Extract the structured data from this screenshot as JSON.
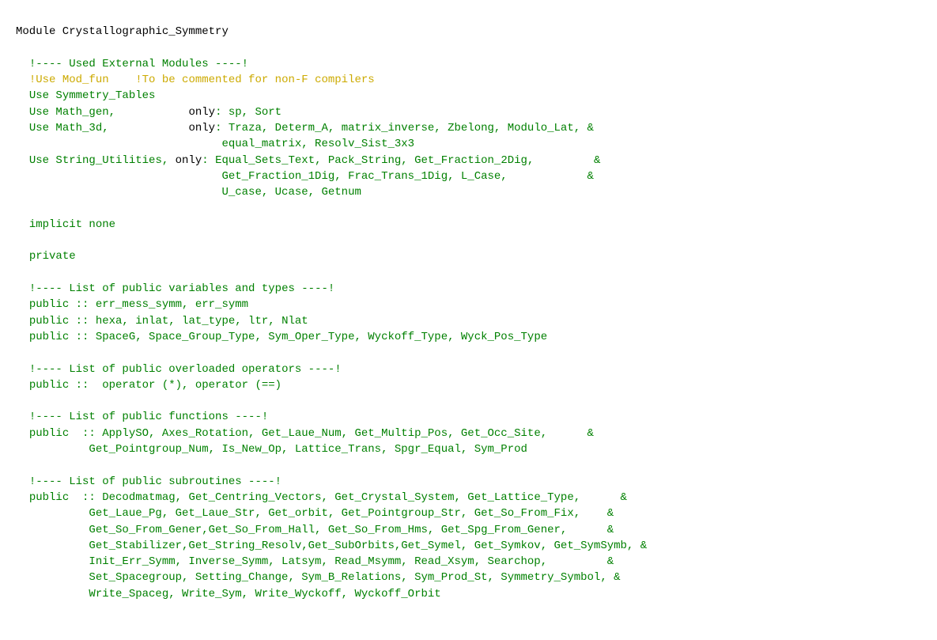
{
  "code": {
    "module_line": "Module Crystallographic_Symmetry",
    "sections": [
      {
        "type": "comment",
        "text": "!---- Used External Modules ----!"
      },
      {
        "type": "comment_yellow",
        "text": "!Use Mod_fun    !To be commented for non-F compilers"
      },
      {
        "type": "use",
        "text": "Use Symmetry_Tables"
      },
      {
        "type": "use",
        "text": "Use Math_gen,           only: sp, Sort"
      },
      {
        "type": "use_multi",
        "text": "Use Math_3d,            only: Traza, Determ_A, matrix_inverse, Zbelong, Modulo_Lat, &\n                               equal_matrix, Resolv_Sist_3x3"
      },
      {
        "type": "use_multi",
        "text": "Use String_Utilities, only: Equal_Sets_Text, Pack_String, Get_Fraction_2Dig,         &\n                               Get_Fraction_1Dig, Frac_Trans_1Dig, L_Case,            &\n                               U_case, Ucase, Getnum"
      },
      {
        "type": "implicit",
        "text": "implicit none"
      },
      {
        "type": "private",
        "text": "private"
      },
      {
        "type": "comment",
        "text": "!---- List of public variables and types ----!"
      },
      {
        "type": "public",
        "text": "public :: err_mess_symm, err_symm"
      },
      {
        "type": "public",
        "text": "public :: hexa, inlat, lat_type, ltr, Nlat"
      },
      {
        "type": "public",
        "text": "public :: SpaceG, Space_Group_Type, Sym_Oper_Type, Wyckoff_Type, Wyck_Pos_Type"
      },
      {
        "type": "comment",
        "text": "!---- List of public overloaded operators ----!"
      },
      {
        "type": "public",
        "text": "public ::  operator (*), operator (==)"
      },
      {
        "type": "comment",
        "text": "!---- List of public functions ----!"
      },
      {
        "type": "public_multi",
        "text": "public  :: ApplySO, Axes_Rotation, Get_Laue_Num, Get_Multip_Pos, Get_Occ_Site,      &\n           Get_Pointgroup_Num, Is_New_Op, Lattice_Trans, Spgr_Equal, Sym_Prod"
      },
      {
        "type": "comment",
        "text": "!---- List of public subroutines ----!"
      },
      {
        "type": "public_multi",
        "text": "public  :: Decodmatmag, Get_Centring_Vectors, Get_Crystal_System, Get_Lattice_Type,      &\n           Get_Laue_Pg, Get_Laue_Str, Get_orbit, Get_Pointgroup_Str, Get_So_From_Fix,    &\n           Get_So_From_Gener,Get_So_From_Hall, Get_So_From_Hms, Get_Spg_From_Gener,      &\n           Get_Stabilizer,Get_String_Resolv,Get_SubOrbits,Get_Symel, Get_Symkov, Get_SymSymb, &\n           Init_Err_Symm, Inverse_Symm, Latsym, Read_Msymm, Read_Xsym, Searchop,         &\n           Set_Spacegroup, Setting_Change, Sym_B_Relations, Sym_Prod_St, Symmetry_Symbol, &\n           Write_Spaceg, Write_Sym, Write_Wyckoff, Wyckoff_Orbit"
      }
    ]
  }
}
